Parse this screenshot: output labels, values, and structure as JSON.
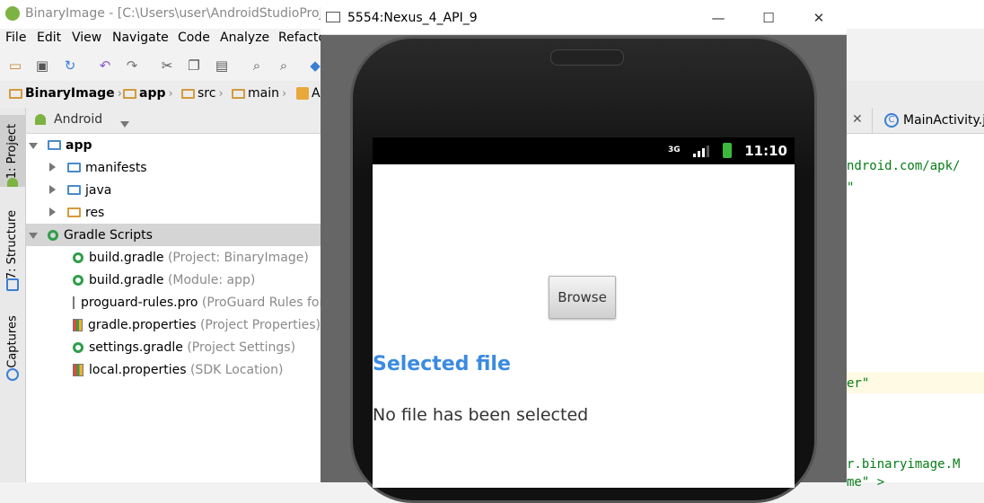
{
  "ide": {
    "title": "BinaryImage - [C:\\Users\\user\\AndroidStudioProjec",
    "menu": [
      "File",
      "Edit",
      "View",
      "Navigate",
      "Code",
      "Analyze",
      "Refacto"
    ],
    "breadcrumb": [
      "BinaryImage",
      "app",
      "src",
      "main"
    ],
    "breadcrumb_partial": "A",
    "side_tabs": [
      "1: Project",
      "7: Structure",
      "Captures"
    ],
    "panel_view": "Android",
    "tree": {
      "app": "app",
      "manifests": "manifests",
      "java": "java",
      "res": "res",
      "gradle_scripts": "Gradle Scripts",
      "files": [
        {
          "name": "build.gradle",
          "note": "(Project: BinaryImage)"
        },
        {
          "name": "build.gradle",
          "note": "(Module: app)"
        },
        {
          "name": "proguard-rules.pro",
          "note": "(ProGuard Rules for"
        },
        {
          "name": "gradle.properties",
          "note": "(Project Properties)"
        },
        {
          "name": "settings.gradle",
          "note": "(Project Settings)"
        },
        {
          "name": "local.properties",
          "note": "(SDK Location)"
        }
      ]
    },
    "editor_tab": "MainActivity.j",
    "code_lines": [
      "ndroid.com/apk/",
      "\"",
      "er\"",
      "r.binaryimage.M",
      "me\" >"
    ]
  },
  "emulator": {
    "window_title": "5554:Nexus_4_API_9",
    "status_time": "11:10",
    "network": "3G",
    "browse_button": "Browse",
    "selected_title": "Selected file",
    "selected_status": "No file has been selected"
  },
  "colors": {
    "accent_blue": "#3b8be0",
    "gradle_green": "#2f9e4a",
    "code_green": "#067d17"
  }
}
